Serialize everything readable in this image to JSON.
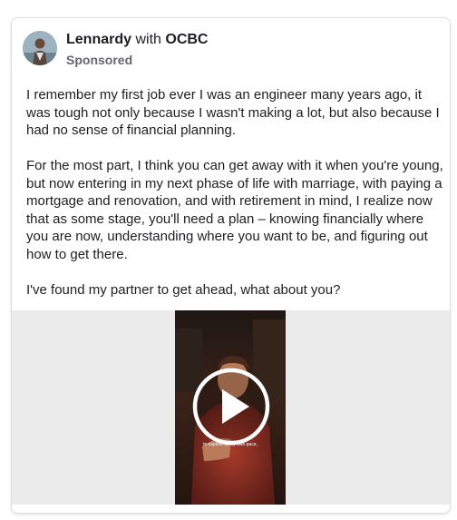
{
  "post": {
    "author": "Lennardy",
    "with_word": "with",
    "partner": "OCBC",
    "sponsored_label": "Sponsored",
    "paragraphs": [
      "I remember my first job ever I was an engineer many years ago, it was tough not only because I wasn't making a lot, but also because I had no sense of financial planning.",
      "For the most part, I think you can get away with it when you're young, but now entering in my next phase of life with marriage, with paying a mortgage and renovation, and with retirement in mind, I realize now that as some stage, you'll need a plan – knowing financially where you are now, understanding where you want to be, and figuring out how to get there.",
      "I've found my partner to get ahead, what about you?"
    ],
    "video": {
      "caption": "to explore at my own pace,",
      "play_icon": "play-icon"
    }
  },
  "colors": {
    "text": "#1c1e21",
    "secondary": "#65676b",
    "media_bg": "#ebebeb",
    "video_tone": "#7a2a22"
  }
}
